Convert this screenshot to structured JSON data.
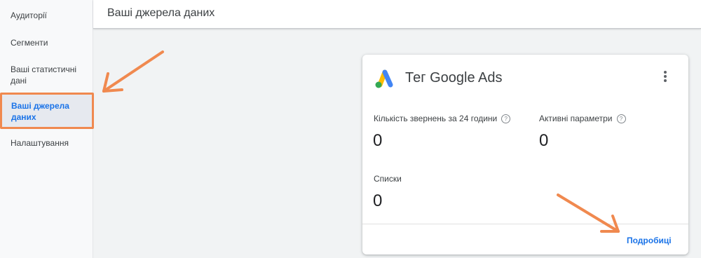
{
  "sidebar": {
    "items": [
      {
        "label": "Аудиторії"
      },
      {
        "label": "Сегменти"
      },
      {
        "label": "Ваші статистичні дані"
      },
      {
        "label": "Ваші джерела даних"
      },
      {
        "label": "Налаштування"
      }
    ],
    "active_index": 3
  },
  "header": {
    "title": "Ваші джерела даних"
  },
  "card": {
    "title": "Тег Google Ads",
    "icon": "google-ads-logo",
    "menu_icon": "more-vert-icon",
    "metrics": [
      {
        "label": "Кількість звернень за 24 години",
        "value": "0",
        "help_icon": "?"
      },
      {
        "label": "Активні параметри",
        "value": "0",
        "help_icon": "?"
      },
      {
        "label": "Списки",
        "value": "0"
      }
    ],
    "details_label": "Подробиці"
  },
  "colors": {
    "accent": "#1a73e8",
    "annotation": "#f0894f",
    "background": "#f1f3f4"
  }
}
